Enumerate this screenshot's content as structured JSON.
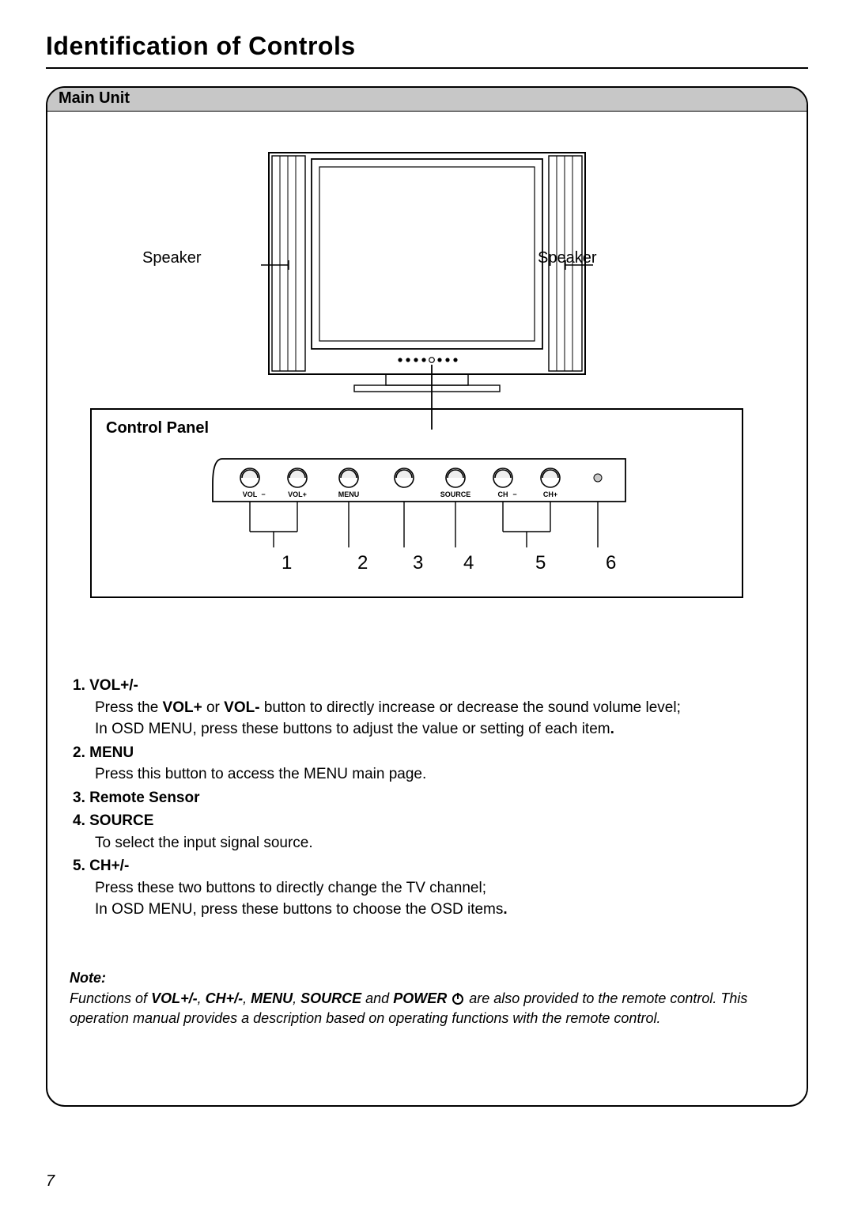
{
  "page_number": "7",
  "title": "Identification of Controls",
  "section_header": "Main Unit",
  "speaker_label_left": "Speaker",
  "speaker_label_right": "Speaker",
  "control_panel_title": "Control Panel",
  "button_labels": [
    "VOL",
    "VOL+",
    "MENU",
    "SOURCE",
    "CH",
    "CH+"
  ],
  "button_sublabels": {
    "vol_minus_sign": "−",
    "ch_minus_sign": "−"
  },
  "callout_numbers": [
    "1",
    "2",
    "3",
    "4",
    "5",
    "6"
  ],
  "descriptions": [
    {
      "head": "1. VOL+/-",
      "body_lines": [
        "Press the <b>VOL+</b> or <b>VOL-</b> button to directly increase or decrease the sound volume level;",
        "In OSD MENU, press these buttons to adjust the value or setting of each item<b>.</b>"
      ]
    },
    {
      "head": "2. MENU",
      "body_lines": [
        "Press this button to access the MENU main page."
      ]
    },
    {
      "head": "3. Remote  Sensor",
      "body_lines": []
    },
    {
      "head": "4. SOURCE",
      "body_lines": [
        "To select the input signal source."
      ]
    },
    {
      "head": "5. CH+/-",
      "body_lines": [
        "Press these two buttons to directly change the TV channel;",
        "In OSD MENU, press these buttons to choose the OSD items<b>.</b>"
      ]
    }
  ],
  "note_head": "Note:",
  "note_body": "Functions of <b>VOL+/-</b>, <b>CH+/-</b>, <b>MENU</b>, <b>SOURCE</b> and <b>POWER</b> {POWER_ICON} are also provided to the remote control. This operation manual provides a description based on operating functions with the remote control."
}
